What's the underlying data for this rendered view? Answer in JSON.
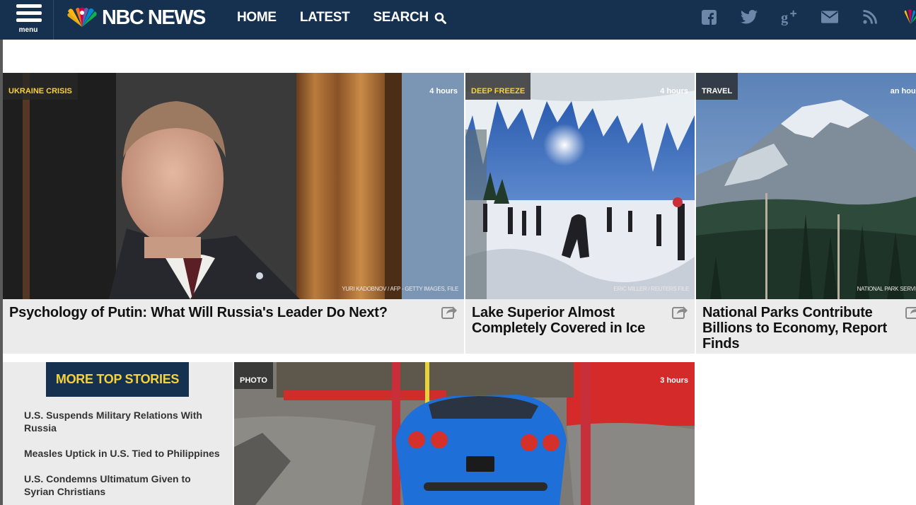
{
  "header": {
    "menu_label": "menu",
    "logo_text": "NBC NEWS",
    "nav": [
      {
        "label": "HOME"
      },
      {
        "label": "LATEST"
      },
      {
        "label": "SEARCH",
        "icon": "search-icon"
      }
    ],
    "social_icons": [
      "facebook-icon",
      "twitter-icon",
      "google-plus-icon",
      "email-icon",
      "rss-icon",
      "nbc-peacock-icon"
    ]
  },
  "stories": [
    {
      "tag": "UKRAINE CRISIS",
      "time": "4 hours",
      "credit": "YURI KADOBNOV / AFP - GETTY IMAGES, FILE",
      "headline": "Psychology of Putin: What Will Russia's Leader Do Next?"
    },
    {
      "tag": "DEEP FREEZE",
      "time": "4 hours",
      "credit": "ERIC MILLER / REUTERS FILE",
      "headline": "Lake Superior Almost Completely Covered in Ice"
    },
    {
      "tag": "TRAVEL",
      "time": "an hour",
      "credit": "NATIONAL PARK SERVICE",
      "headline": "National Parks Contribute Billions to Economy, Report Finds"
    },
    {
      "tag": "PHOTO",
      "time": "3 hours"
    }
  ],
  "more_top_stories": {
    "title": "MORE TOP STORIES",
    "items": [
      "U.S. Suspends Military Relations With Russia",
      "Measles Uptick in U.S. Tied to Philippines",
      "U.S. Condemns Ultimatum Given to Syrian Christians"
    ]
  },
  "colors": {
    "nav_bg": "#15314f",
    "tag_text": "#f5d23a",
    "card_bg": "#ebebeb"
  }
}
